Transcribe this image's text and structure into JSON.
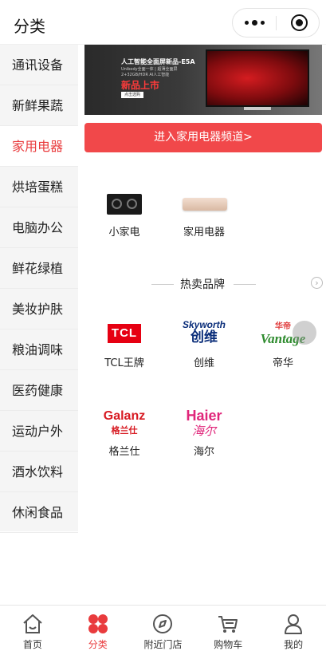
{
  "header": {
    "title": "分类"
  },
  "sidebar": {
    "items": [
      {
        "label": "通讯设备"
      },
      {
        "label": "新鲜果蔬"
      },
      {
        "label": "家用电器"
      },
      {
        "label": "烘培蛋糕"
      },
      {
        "label": "电脑办公"
      },
      {
        "label": "鲜花绿植"
      },
      {
        "label": "美妆护肤"
      },
      {
        "label": "粮油调味"
      },
      {
        "label": "医药健康"
      },
      {
        "label": "运动户外"
      },
      {
        "label": "酒水饮料"
      },
      {
        "label": "休闲食品"
      }
    ],
    "active_index": 2
  },
  "banner": {
    "headline": "人工智能全面屏新品-E5A",
    "subtext": "Unibody全面一体 | 超薄全面屏 2+32GB/HDR AI人工智能",
    "tag": "新品上市",
    "button": "点击选购"
  },
  "channel_button": {
    "label": "进入家用电器频道>"
  },
  "subcategories": [
    {
      "label": "小家电",
      "icon": "cooktop-icon"
    },
    {
      "label": "家用电器",
      "icon": "air-conditioner-icon"
    }
  ],
  "hot_brands": {
    "title": "热卖品牌",
    "items": [
      {
        "label": "TCL王牌",
        "logo_text": "TCL"
      },
      {
        "label": "创维",
        "logo_en": "Skyworth",
        "logo_cn": "创维"
      },
      {
        "label": "帝华",
        "logo_cn": "华帝",
        "logo_en": "Vantage"
      },
      {
        "label": "格兰仕",
        "logo_en": "Galanz",
        "logo_cn": "格兰仕"
      },
      {
        "label": "海尔",
        "logo_en": "Haier",
        "logo_cn": "海尔"
      }
    ]
  },
  "tabbar": {
    "items": [
      {
        "label": "首页",
        "icon": "home-icon"
      },
      {
        "label": "分类",
        "icon": "category-icon"
      },
      {
        "label": "附近门店",
        "icon": "compass-icon"
      },
      {
        "label": "购物车",
        "icon": "cart-icon"
      },
      {
        "label": "我的",
        "icon": "user-icon"
      }
    ],
    "active_index": 1
  },
  "colors": {
    "accent": "#e93b3d",
    "button": "#f1484a",
    "sidebar_bg": "#f5f5f5"
  }
}
